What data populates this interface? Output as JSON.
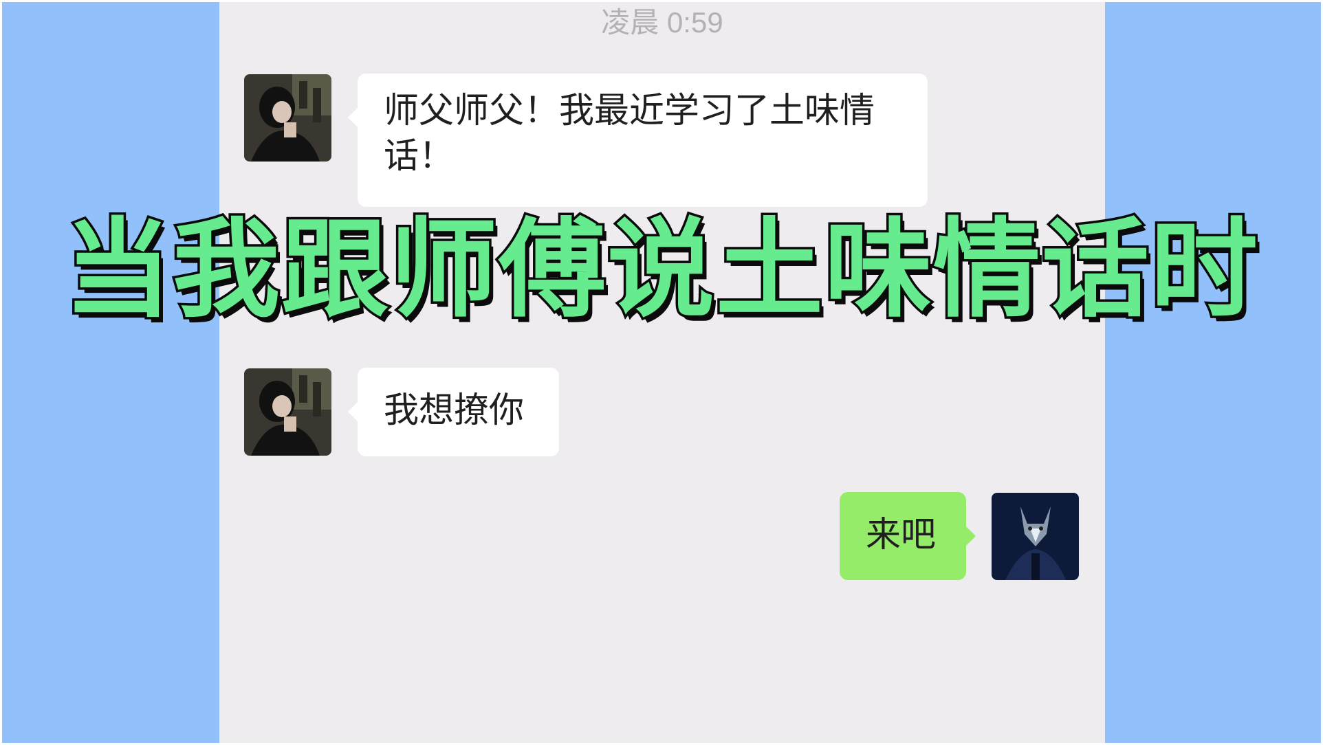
{
  "chat": {
    "timestamp": "凌晨 0:59",
    "messages": [
      {
        "sender": "other",
        "text": "师父师父！我最近学习了土味情话！",
        "line1": "师父师父！我最近学习了土味情",
        "line2": "话！"
      },
      {
        "sender": "other",
        "text": "我想撩你"
      },
      {
        "sender": "me",
        "text": "来吧"
      }
    ]
  },
  "overlay": {
    "title": "当我跟师傅说土味情话时"
  },
  "colors": {
    "frame_background": "#92c0fa",
    "chat_background": "#efecf0",
    "my_bubble": "#95ec69",
    "title_fill": "#66ec8e",
    "title_outline": "#0b0b0b"
  },
  "icons": {
    "other_avatar": "avatar-girl-photo",
    "my_avatar": "avatar-wolf-photo"
  }
}
